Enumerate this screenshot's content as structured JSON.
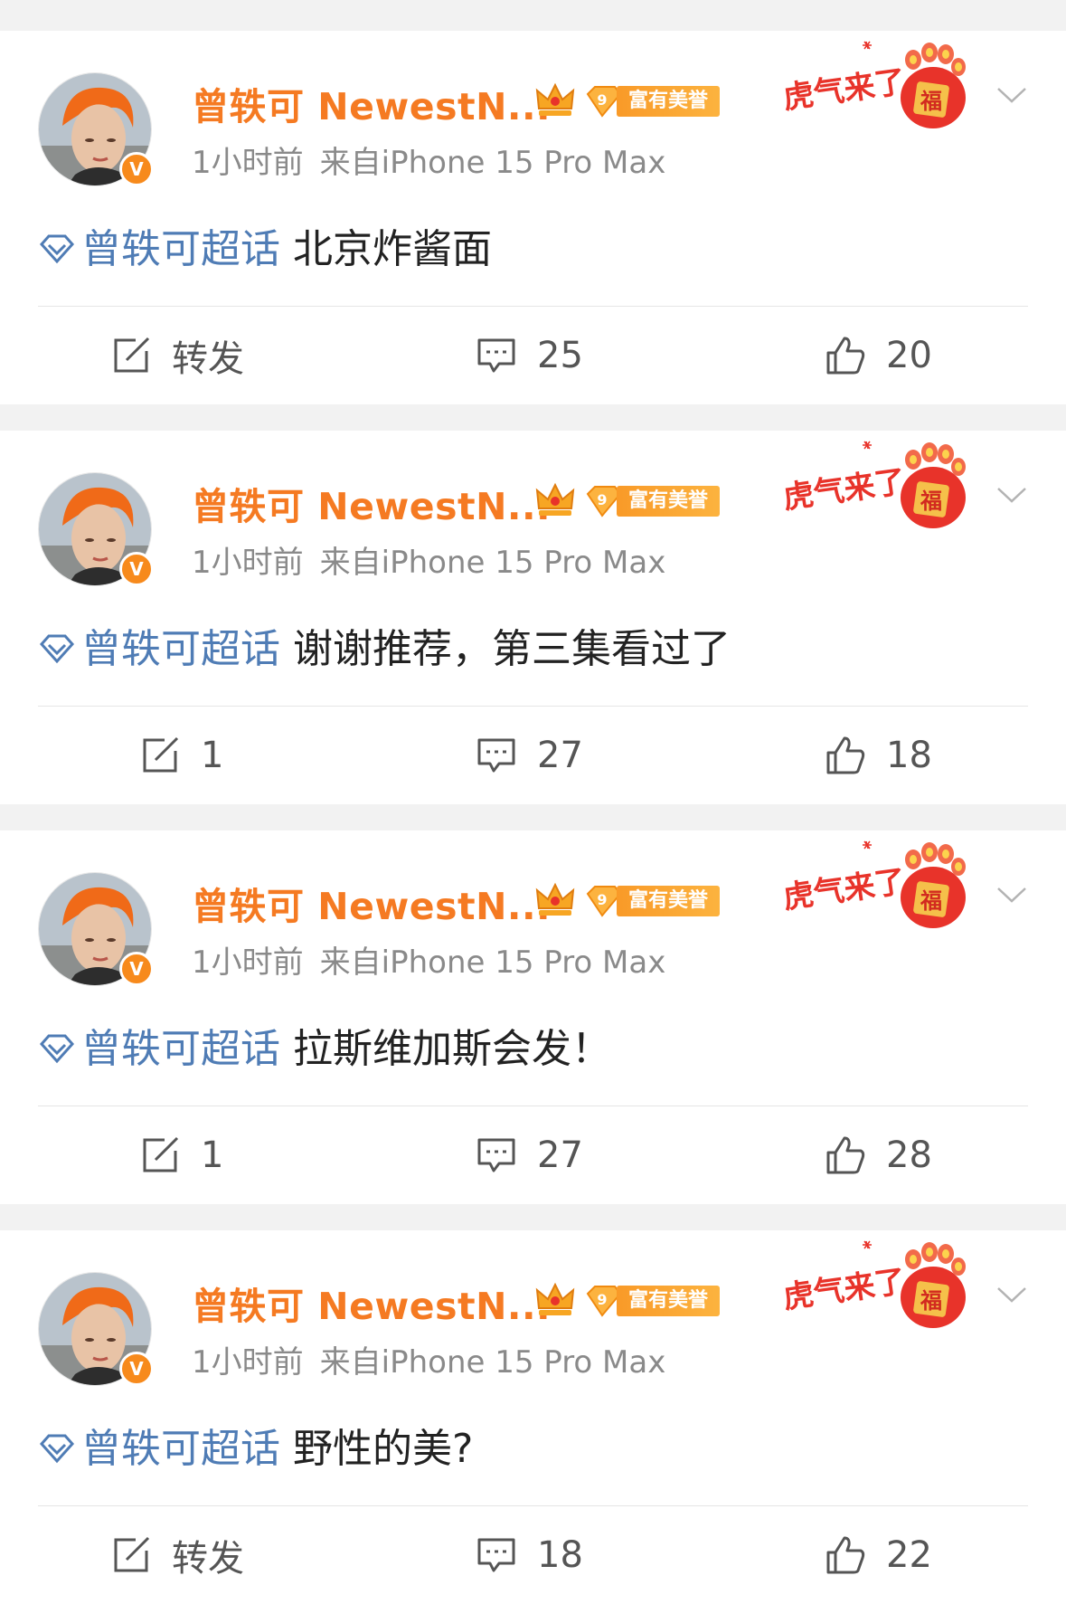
{
  "colors": {
    "username": "#f57a22",
    "topic": "#4f7cb5",
    "meta": "#8a8a8a",
    "honor_badge": "#f99a28",
    "holiday": "#e8332a"
  },
  "badges": {
    "verified_mark": "V",
    "honor_level": "9",
    "honor_label": "富有美誉",
    "holiday_label": "虎气来了",
    "holiday_stamp": "福"
  },
  "posts": [
    {
      "username": "曾轶可 NewestN...",
      "time": "1小时前",
      "source": "来自iPhone 15 Pro Max",
      "topic": "曾轶可超话",
      "text": "北京炸酱面",
      "repost": "转发",
      "comments": "25",
      "likes": "20"
    },
    {
      "username": "曾轶可 NewestN...",
      "time": "1小时前",
      "source": "来自iPhone 15 Pro Max",
      "topic": "曾轶可超话",
      "text": "谢谢推荐，第三集看过了",
      "repost": "1",
      "comments": "27",
      "likes": "18"
    },
    {
      "username": "曾轶可 NewestN...",
      "time": "1小时前",
      "source": "来自iPhone 15 Pro Max",
      "topic": "曾轶可超话",
      "text": "拉斯维加斯会发！",
      "repost": "1",
      "comments": "27",
      "likes": "28"
    },
    {
      "username": "曾轶可 NewestN...",
      "time": "1小时前",
      "source": "来自iPhone 15 Pro Max",
      "topic": "曾轶可超话",
      "text": "野性的美?",
      "repost": "转发",
      "comments": "18",
      "likes": "22"
    }
  ]
}
